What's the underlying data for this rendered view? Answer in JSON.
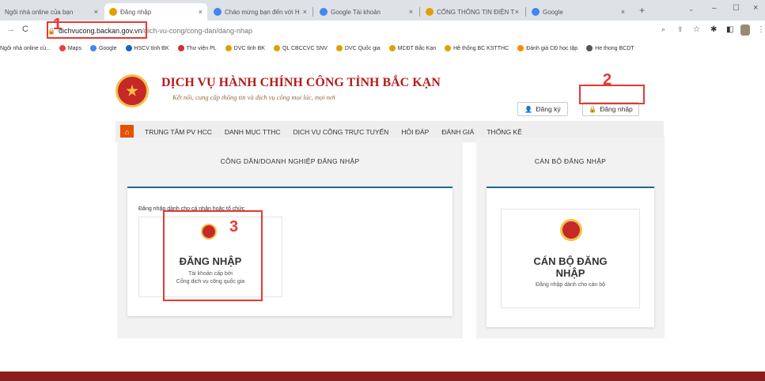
{
  "browser": {
    "tabs": [
      {
        "title": "Ngôi nhà online của bạn",
        "active": false
      },
      {
        "title": "Đăng nhập",
        "active": true
      },
      {
        "title": "Chào mừng bạn đến với H",
        "active": false
      },
      {
        "title": "Google Tài khoản",
        "active": false
      },
      {
        "title": "CỔNG THÔNG TIN ĐIỆN T",
        "active": false
      },
      {
        "title": "Google",
        "active": false
      }
    ],
    "url_host": "dichvucong.backan.gov.vn",
    "url_path": "/dich-vu-cong/cong-dan/dang-nhap",
    "bookmarks": [
      "Ngôi nhà online cù...",
      "Maps",
      "Google",
      "HSCV tỉnh BK",
      "Thư viện PL",
      "DVC tỉnh BK",
      "QL CBCCVC SNV",
      "DVC Quốc gia",
      "MCĐT Bắc Kạn",
      "Hệ thống BC KSTTHC",
      "Đánh giá CĐ học tập",
      "He thong BCDT"
    ]
  },
  "site": {
    "title": "DỊCH VỤ HÀNH CHÍNH CÔNG TỈNH BẮC KẠN",
    "subtitle": "Kết nối, cung cấp thông tin và dịch vụ công mọi lúc, mọi nơi",
    "register_label": "Đăng ký",
    "login_label": "Đăng nhập",
    "nav": [
      "TRUNG TÂM PV HCC",
      "DANH MỤC TTHC",
      "DỊCH VỤ CÔNG TRỰC TUYẾN",
      "HỎI ĐÁP",
      "ĐÁNH GIÁ",
      "THỐNG KÊ"
    ]
  },
  "citizen": {
    "heading": "CÔNG DÂN/DOANH NGHIỆP ĐĂNG NHẬP",
    "note": "Đăng nhập dành cho cá nhân hoặc tổ chức",
    "login_title": "ĐĂNG NHẬP",
    "login_line1": "Tài khoản cấp bởi",
    "login_line2": "Cổng dịch vụ công quốc gia"
  },
  "officer": {
    "heading": "CÁN BỘ ĐĂNG NHẬP",
    "login_title_1": "CÁN BỘ ĐĂNG",
    "login_title_2": "NHẬP",
    "login_note": "Đăng nhập dành cho cán bộ"
  },
  "annotations": [
    "1",
    "2",
    "3"
  ]
}
